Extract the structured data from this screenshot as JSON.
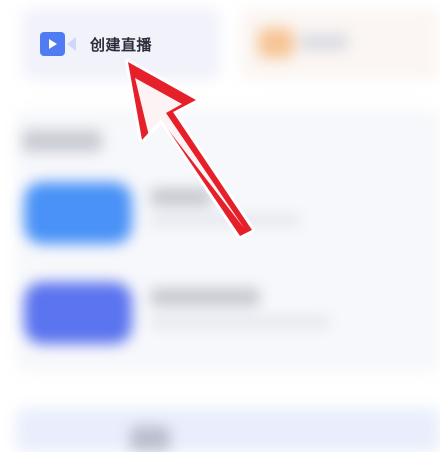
{
  "top_actions": {
    "create_live": {
      "label": "创建直播",
      "icon": "video-camera-icon"
    }
  },
  "colors": {
    "accent_blue": "#4f7cf3",
    "annotation_red": "#e5202a"
  }
}
